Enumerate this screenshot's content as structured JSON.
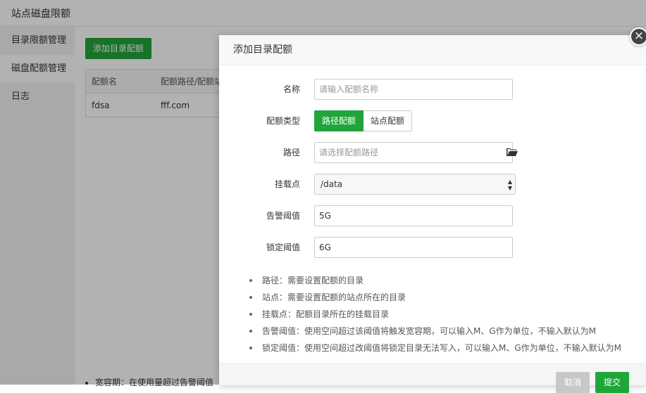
{
  "app": {
    "title": "站点磁盘限额",
    "sidebar": [
      {
        "label": "目录限额管理"
      },
      {
        "label": "磁盘配额管理"
      },
      {
        "label": "日志"
      }
    ],
    "add_button": "添加目录配额",
    "table": {
      "columns": [
        "配额名",
        "配额路径/配额站"
      ],
      "rows": [
        [
          "fdsa",
          "fff.com"
        ]
      ]
    },
    "bottom_note": "宽容期：在使用量超过告警阈值"
  },
  "modal": {
    "title": "添加目录配额",
    "close_icon": "close-icon",
    "fields": {
      "name": {
        "label": "名称",
        "placeholder": "请输入配额名称",
        "value": ""
      },
      "type": {
        "label": "配额类型",
        "options": [
          "路径配额",
          "站点配额"
        ],
        "selected": "路径配额"
      },
      "path": {
        "label": "路径",
        "placeholder": "请选择配额路径",
        "value": "",
        "icon": "folder-icon"
      },
      "mount": {
        "label": "挂载点",
        "value": "/data"
      },
      "warn": {
        "label": "告警阈值",
        "value": "5G"
      },
      "lock": {
        "label": "锁定阈值",
        "value": "6G"
      }
    },
    "tips": [
      "路径：需要设置配额的目录",
      "站点：需要设置配额的站点所在的目录",
      "挂载点：配额目录所在的挂载目录",
      "告警阈值：使用空间超过该阈值将触发宽容期，可以输入M、G作为单位，不输入默认为M",
      "锁定阈值：使用空间超过改阈值将锁定目录无法写入，可以输入M、G作为单位，不输入默认为M"
    ],
    "buttons": {
      "cancel": "取消",
      "submit": "提交"
    }
  },
  "colors": {
    "accent": "#20a53a",
    "overlay": "rgba(0,0,0,0.3)"
  }
}
